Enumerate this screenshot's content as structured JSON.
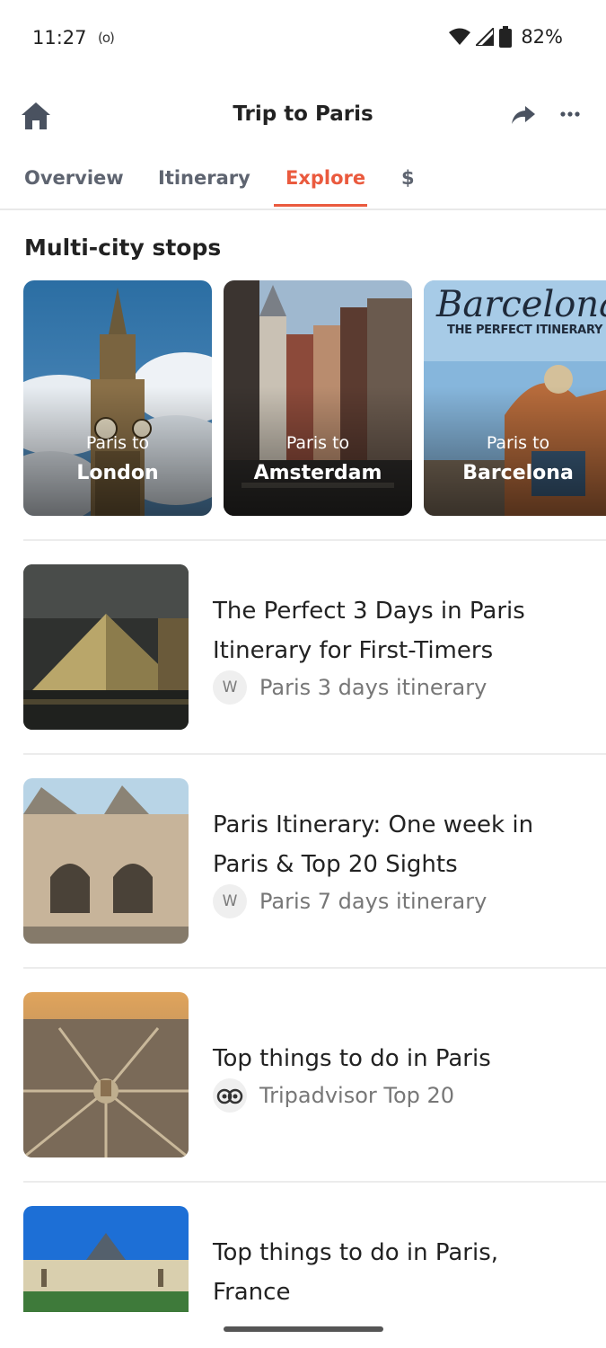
{
  "status_bar": {
    "time": "11:27",
    "radio_icon": "(o)",
    "battery": "82%"
  },
  "header": {
    "title": "Trip to Paris"
  },
  "tabs": [
    {
      "label": "Overview"
    },
    {
      "label": "Itinerary"
    },
    {
      "label": "Explore",
      "active": true
    },
    {
      "label": "$"
    }
  ],
  "section_title": "Multi-city stops",
  "cards": [
    {
      "line1": "Paris to",
      "line2": "London"
    },
    {
      "line1": "Paris to",
      "line2": "Amsterdam"
    },
    {
      "line1": "Paris to",
      "line2": "Barcelona"
    }
  ],
  "card_overlay_text": {
    "barcelona_script": "Barcelona",
    "barcelona_sub": "THE PERFECT ITINERARY"
  },
  "items": [
    {
      "title": "The Perfect 3 Days in Paris Itinerary for First-Timers",
      "source_avatar": "W",
      "source": "Paris 3 days itinerary"
    },
    {
      "title": "Paris Itinerary: One week in Paris & Top 20 Sights",
      "source_avatar": "W",
      "source": "Paris 7 days itinerary"
    },
    {
      "title": "Top things to do in Paris",
      "source": "Tripadvisor Top 20"
    },
    {
      "title": "Top things to do in Paris, France"
    }
  ],
  "colors": {
    "accent": "#ea5a3e",
    "text": "#222222",
    "muted": "#777777"
  }
}
